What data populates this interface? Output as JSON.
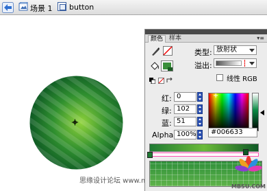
{
  "breadcrumb": {
    "scene_label": "场景 1",
    "symbol_label": "button"
  },
  "stage": {
    "fill_colors": [
      "#0e5a24",
      "#2f8f2f",
      "#8fd23b"
    ],
    "caption": "思缘设计论坛 www.missyuan.com"
  },
  "color_panel": {
    "tabs": [
      "颜色",
      "样本"
    ],
    "active_tab": "颜色",
    "menu_icon": "panel-menu-icon",
    "type_label": "类型:",
    "type_value": "放射状",
    "overflow_label": "溢出:",
    "linear_rgb_label": "线性 RGB",
    "linear_rgb_checked": false,
    "red_label": "红:",
    "red_value": "0",
    "green_label": "绿:",
    "green_value": "102",
    "blue_label": "蓝:",
    "blue_value": "51",
    "alpha_label": "Alpha:",
    "alpha_value": "100%",
    "hex_value": "#006633",
    "selected_color": "#006633",
    "gradient_stops": [
      "#1f7a33",
      "#0f5a26"
    ],
    "watermark": "MBSU.COM"
  }
}
